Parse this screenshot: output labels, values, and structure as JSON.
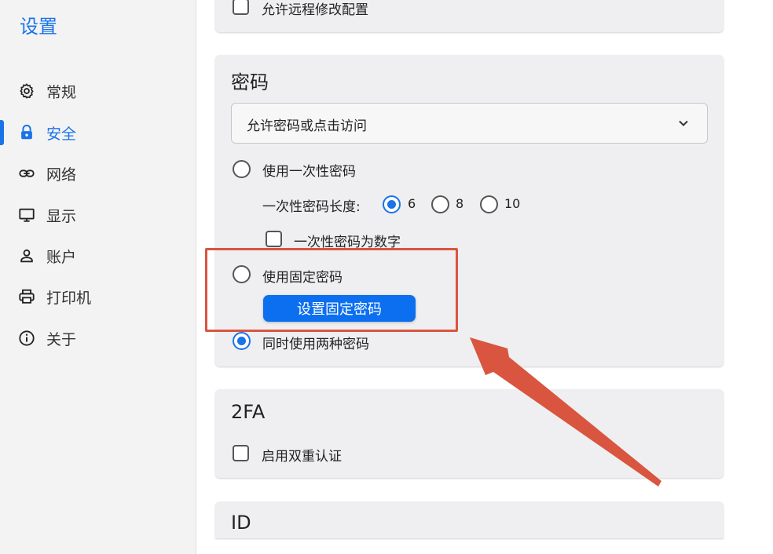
{
  "sidebar": {
    "title": "设置",
    "items": [
      {
        "label": "常规",
        "icon": "gear-icon"
      },
      {
        "label": "安全",
        "icon": "lock-icon",
        "active": true
      },
      {
        "label": "网络",
        "icon": "link-icon"
      },
      {
        "label": "显示",
        "icon": "monitor-icon"
      },
      {
        "label": "账户",
        "icon": "person-icon"
      },
      {
        "label": "打印机",
        "icon": "printer-icon"
      },
      {
        "label": "关于",
        "icon": "info-icon"
      }
    ]
  },
  "top_card": {
    "checkbox_label": "允许远程修改配置",
    "checked": false
  },
  "password": {
    "title": "密码",
    "select_value": "允许密码或点击访问",
    "one_time_label": "使用一次性密码",
    "length_label": "一次性密码长度:",
    "length_options": [
      "6",
      "8",
      "10"
    ],
    "length_selected": "6",
    "numeric_label": "一次性密码为数字",
    "fixed_label": "使用固定密码",
    "set_fixed_button": "设置固定密码",
    "both_label": "同时使用两种密码",
    "selected_mode": "both"
  },
  "twofa": {
    "title": "2FA",
    "enable_label": "启用双重认证",
    "checked": false
  },
  "id_section": {
    "title": "ID"
  },
  "colors": {
    "accent": "#1a73e8",
    "button": "#0b6ff0",
    "annotation": "#d9553f"
  }
}
